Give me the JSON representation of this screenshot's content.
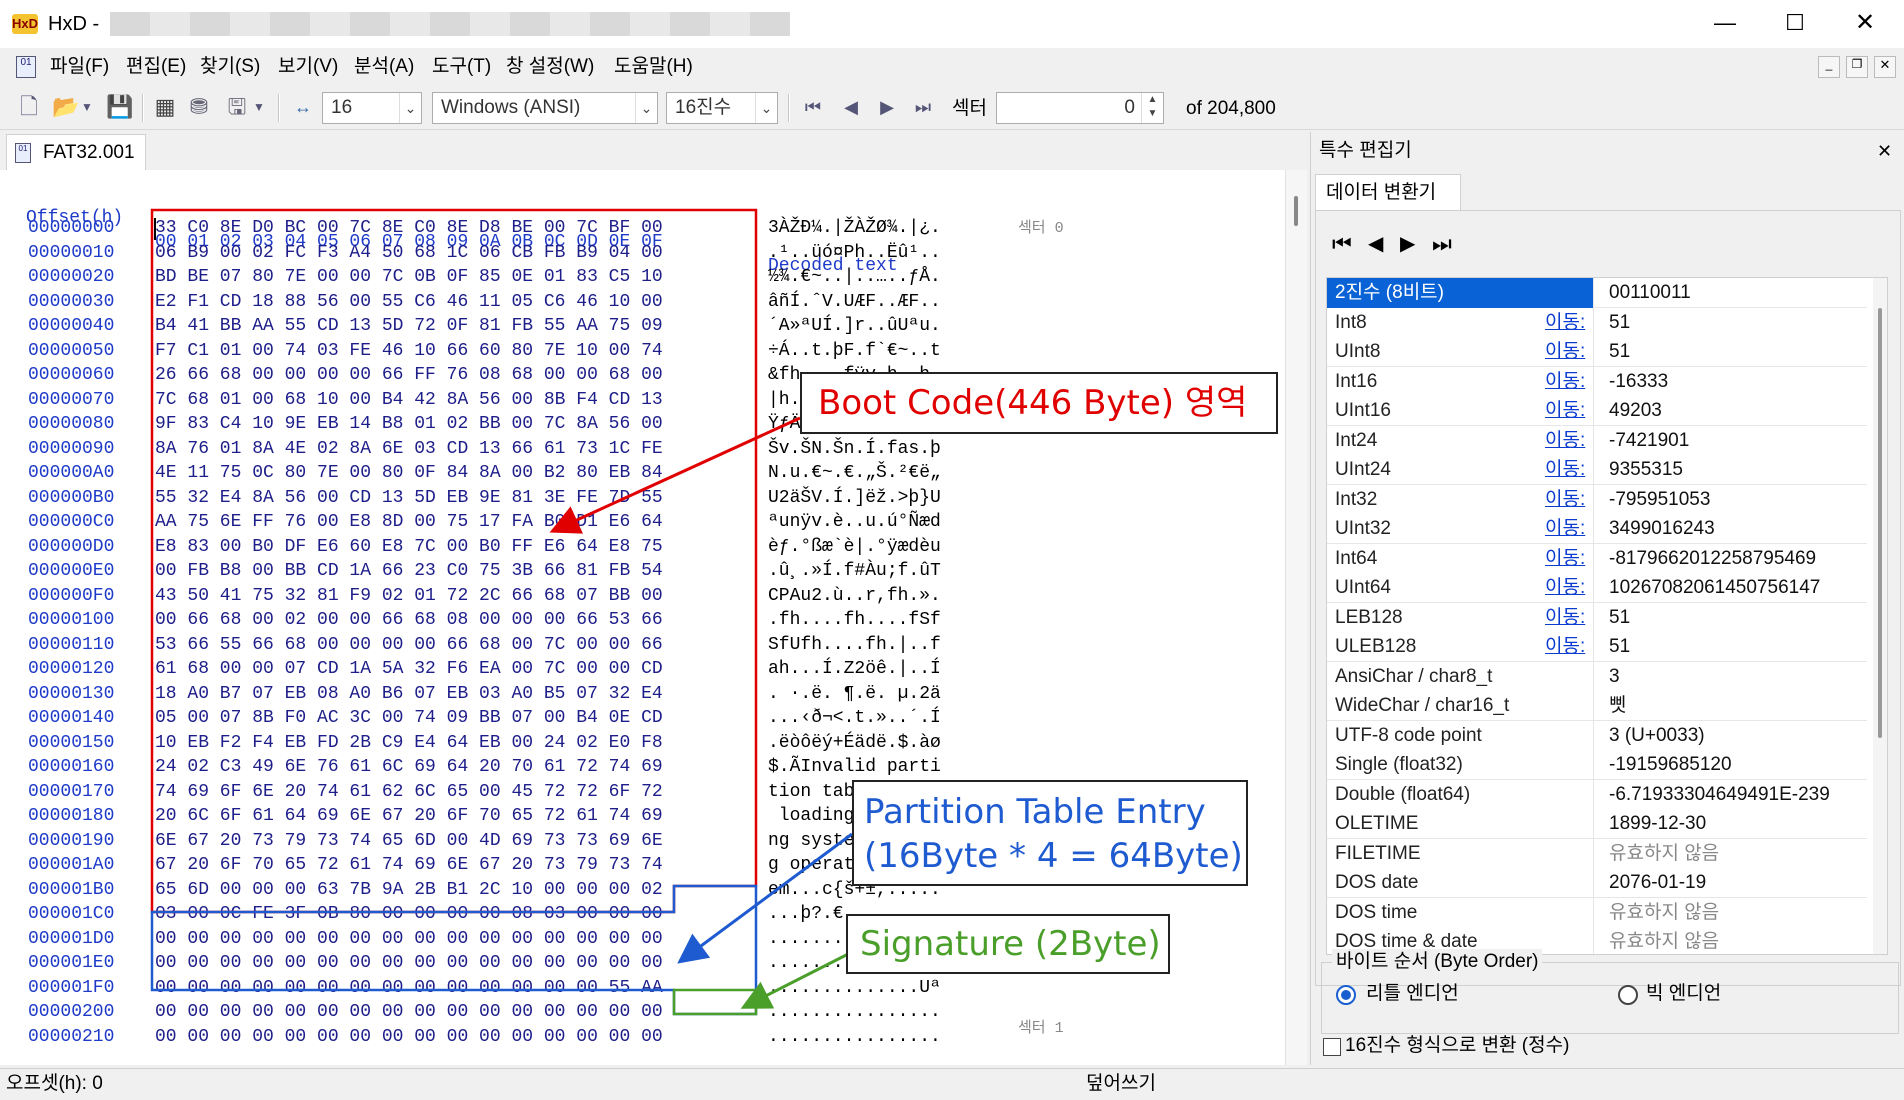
{
  "app": {
    "name": "HxD -"
  },
  "menu": [
    "파일(F)",
    "편집(E)",
    "찾기(S)",
    "보기(V)",
    "분석(A)",
    "도구(T)",
    "창 설정(W)",
    "도움말(H)"
  ],
  "toolbar": {
    "bytes_per_row": "16",
    "charset": "Windows (ANSI)",
    "numbase": "16진수",
    "sector_label": "섹터",
    "sector_value": "0",
    "sector_of": "of 204,800"
  },
  "tab": {
    "label": "FAT32.001"
  },
  "hex": {
    "header_offset": "Offset(h)",
    "header_cols": "00 01 02 03 04 05 06 07 08 09 0A 0B 0C 0D 0E 0F",
    "header_decoded": "Decoded text",
    "sector0_label": "섹터 0",
    "sector1_label": "섹터 1",
    "rows": [
      {
        "off": "00000000",
        "bytes": "33 C0 8E D0 BC 00 7C 8E C0 8E D8 BE 00 7C BF 00",
        "text": "3ÀŽÐ¼.|ŽÀŽØ¾.|¿."
      },
      {
        "off": "00000010",
        "bytes": "06 B9 00 02 FC F3 A4 50 68 1C 06 CB FB B9 04 00",
        "text": ".¹..üó¤Ph..Ëû¹.."
      },
      {
        "off": "00000020",
        "bytes": "BD BE 07 80 7E 00 00 7C 0B 0F 85 0E 01 83 C5 10",
        "text": "½¾.€~..|..…..ƒÅ."
      },
      {
        "off": "00000030",
        "bytes": "E2 F1 CD 18 88 56 00 55 C6 46 11 05 C6 46 10 00",
        "text": "âñÍ.ˆV.UÆF..ÆF.."
      },
      {
        "off": "00000040",
        "bytes": "B4 41 BB AA 55 CD 13 5D 72 0F 81 FB 55 AA 75 09",
        "text": "´A»ªUÍ.]r..ûUªu."
      },
      {
        "off": "00000050",
        "bytes": "F7 C1 01 00 74 03 FE 46 10 66 60 80 7E 10 00 74",
        "text": "÷Á..t.þF.f`€~..t"
      },
      {
        "off": "00000060",
        "bytes": "26 66 68 00 00 00 00 66 FF 76 08 68 00 00 68 00",
        "text": "&fh....fÿv.h..h."
      },
      {
        "off": "00000070",
        "bytes": "7C 68 01 00 68 10 00 B4 42 8A 56 00 8B F4 CD 13",
        "text": "|h..h..´BŠV.‹ôÍ."
      },
      {
        "off": "00000080",
        "bytes": "9F 83 C4 10 9E EB 14 B8 01 02 BB 00 7C 8A 56 00",
        "text": "ŸƒÄ.žë.¸..».|ŠV."
      },
      {
        "off": "00000090",
        "bytes": "8A 76 01 8A 4E 02 8A 6E 03 CD 13 66 61 73 1C FE",
        "text": "Šv.ŠN.Šn.Í.fas.þ"
      },
      {
        "off": "000000A0",
        "bytes": "4E 11 75 0C 80 7E 00 80 0F 84 8A 00 B2 80 EB 84",
        "text": "N.u.€~.€.„Š.²€ë„"
      },
      {
        "off": "000000B0",
        "bytes": "55 32 E4 8A 56 00 CD 13 5D EB 9E 81 3E FE 7D 55",
        "text": "U2äŠV.Í.]ëž.>þ}U"
      },
      {
        "off": "000000C0",
        "bytes": "AA 75 6E FF 76 00 E8 8D 00 75 17 FA B0 D1 E6 64",
        "text": "ªunÿv.è..u.ú°Ñæd"
      },
      {
        "off": "000000D0",
        "bytes": "E8 83 00 B0 DF E6 60 E8 7C 00 B0 FF E6 64 E8 75",
        "text": "èƒ.°ßæ`è|.°ÿædèu"
      },
      {
        "off": "000000E0",
        "bytes": "00 FB B8 00 BB CD 1A 66 23 C0 75 3B 66 81 FB 54",
        "text": ".û¸.»Í.f#Àu;f.ûT"
      },
      {
        "off": "000000F0",
        "bytes": "43 50 41 75 32 81 F9 02 01 72 2C 66 68 07 BB 00",
        "text": "CPAu2.ù..r,fh.»."
      },
      {
        "off": "00000100",
        "bytes": "00 66 68 00 02 00 00 66 68 08 00 00 00 66 53 66",
        "text": ".fh....fh....fSf"
      },
      {
        "off": "00000110",
        "bytes": "53 66 55 66 68 00 00 00 00 66 68 00 7C 00 00 66",
        "text": "SfUfh....fh.|..f"
      },
      {
        "off": "00000120",
        "bytes": "61 68 00 00 07 CD 1A 5A 32 F6 EA 00 7C 00 00 CD",
        "text": "ah...Í.Z2öê.|..Í"
      },
      {
        "off": "00000130",
        "bytes": "18 A0 B7 07 EB 08 A0 B6 07 EB 03 A0 B5 07 32 E4",
        "text": ". ·.ë. ¶.ë. µ.2ä"
      },
      {
        "off": "00000140",
        "bytes": "05 00 07 8B F0 AC 3C 00 74 09 BB 07 00 B4 0E CD",
        "text": "...‹ð¬<.t.»..´.Í"
      },
      {
        "off": "00000150",
        "bytes": "10 EB F2 F4 EB FD 2B C9 E4 64 EB 00 24 02 E0 F8",
        "text": ".ëòôëý+Éädë.$.àø"
      },
      {
        "off": "00000160",
        "bytes": "24 02 C3 49 6E 76 61 6C 69 64 20 70 61 72 74 69",
        "text": "$.ÃInvalid parti"
      },
      {
        "off": "00000170",
        "bytes": "74 69 6F 6E 20 74 61 62 6C 65 00 45 72 72 6F 72",
        "text": "tion table.Error"
      },
      {
        "off": "00000180",
        "bytes": "20 6C 6F 61 64 69 6E 67 20 6F 70 65 72 61 74 69",
        "text": " loading operati"
      },
      {
        "off": "00000190",
        "bytes": "6E 67 20 73 79 73 74 65 6D 00 4D 69 73 73 69 6E",
        "text": "ng system.Missin"
      },
      {
        "off": "000001A0",
        "bytes": "67 20 6F 70 65 72 61 74 69 6E 67 20 73 79 73 74",
        "text": "g operating syst"
      },
      {
        "off": "000001B0",
        "bytes": "65 6D 00 00 00 63 7B 9A 2B B1 2C 10 00 00 00 02",
        "text": "em...c{š+±,....."
      },
      {
        "off": "000001C0",
        "bytes": "03 00 0C FE 3F 0B 80 00 00 00 00 08 03 00 00 00",
        "text": "...þ?.€........."
      },
      {
        "off": "000001D0",
        "bytes": "00 00 00 00 00 00 00 00 00 00 00 00 00 00 00 00",
        "text": "................"
      },
      {
        "off": "000001E0",
        "bytes": "00 00 00 00 00 00 00 00 00 00 00 00 00 00 00 00",
        "text": "................"
      },
      {
        "off": "000001F0",
        "bytes": "00 00 00 00 00 00 00 00 00 00 00 00 00 00 55 AA",
        "text": "..............Uª"
      },
      {
        "off": "00000200",
        "bytes": "00 00 00 00 00 00 00 00 00 00 00 00 00 00 00 00",
        "text": "................"
      },
      {
        "off": "00000210",
        "bytes": "00 00 00 00 00 00 00 00 00 00 00 00 00 00 00 00",
        "text": "................"
      }
    ]
  },
  "annotations": {
    "boot": "Boot Code(446 Byte) 영역",
    "partition_line1": "Partition Table Entry",
    "partition_line2": "(16Byte * 4 = 64Byte)",
    "signature": "Signature (2Byte)",
    "colors": {
      "boot": "#e00000",
      "partition": "#1f5bd0",
      "signature": "#4a9e2a"
    }
  },
  "panel": {
    "title": "특수 편집기",
    "tab": "데이터 변환기",
    "link_label": "이동:",
    "rows": [
      {
        "name": "2진수 (8비트)",
        "value": "00110011",
        "selected": true,
        "link": false
      },
      {
        "name": "Int8",
        "value": "51",
        "link": true
      },
      {
        "name": "UInt8",
        "value": "51",
        "link": true
      },
      {
        "name": "Int16",
        "value": "-16333",
        "link": true
      },
      {
        "name": "UInt16",
        "value": "49203",
        "link": true
      },
      {
        "name": "Int24",
        "value": "-7421901",
        "link": true
      },
      {
        "name": "UInt24",
        "value": "9355315",
        "link": true
      },
      {
        "name": "Int32",
        "value": "-795951053",
        "link": true
      },
      {
        "name": "UInt32",
        "value": "3499016243",
        "link": true
      },
      {
        "name": "Int64",
        "value": "-8179662012258795469",
        "link": true
      },
      {
        "name": "UInt64",
        "value": "10267082061450756147",
        "link": true
      },
      {
        "name": "LEB128",
        "value": "51",
        "link": true
      },
      {
        "name": "ULEB128",
        "value": "51",
        "link": true
      },
      {
        "name": "AnsiChar / char8_t",
        "value": "3",
        "link": false
      },
      {
        "name": "WideChar / char16_t",
        "value": "삣",
        "link": false
      },
      {
        "name": "UTF-8 code point",
        "value": "3 (U+0033)",
        "link": false
      },
      {
        "name": "Single (float32)",
        "value": "-19159685120",
        "link": false
      },
      {
        "name": "Double (float64)",
        "value": "-6.71933304649491E-239",
        "link": false
      },
      {
        "name": "OLETIME",
        "value": "1899-12-30",
        "link": false
      },
      {
        "name": "FILETIME",
        "value": "유효하지 않음",
        "link": false,
        "grey": true
      },
      {
        "name": "DOS date",
        "value": "2076-01-19",
        "link": false
      },
      {
        "name": "DOS time",
        "value": "유효하지 않음",
        "link": false,
        "grey": true
      },
      {
        "name": "DOS time & date",
        "value": "유효하지 않음",
        "link": false,
        "grey": true
      }
    ],
    "byte_order_title": "바이트 순서 (Byte Order)",
    "little_endian": "리틀 엔디언",
    "big_endian": "빅 엔디언",
    "hex_checkbox": "16진수 형식으로 변환 (정수)"
  },
  "status": {
    "offset": "오프셋(h): 0",
    "mode": "덮어쓰기"
  }
}
